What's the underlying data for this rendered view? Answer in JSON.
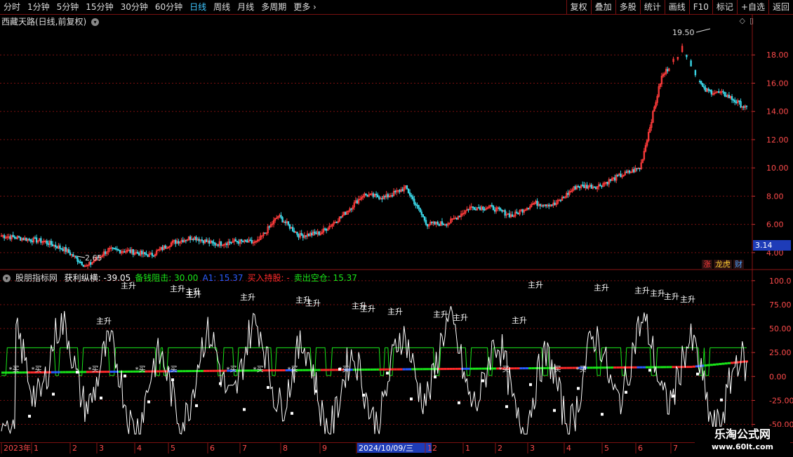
{
  "toolbar": {
    "timeframes": [
      "分时",
      "1分钟",
      "5分钟",
      "15分钟",
      "30分钟",
      "60分钟",
      "日线",
      "周线",
      "月线",
      "多周期",
      "更多"
    ],
    "active_timeframe": "日线",
    "tools": [
      "复权",
      "叠加",
      "多股",
      "统计",
      "画线",
      "F10",
      "标记",
      "+自选",
      "返回"
    ]
  },
  "upper_pane": {
    "stock_title": "西藏天路(日线,前复权)",
    "y_ticks": [
      "18.00",
      "16.00",
      "14.00",
      "12.00",
      "10.00",
      "8.00",
      "6.00",
      "4.00"
    ],
    "high_label": "19.50",
    "low_label": "2.65",
    "current_price": "3.14",
    "badges": [
      "涨",
      "龙虎",
      "财"
    ]
  },
  "lower_pane": {
    "indicator_name": "股朋指标网",
    "values": [
      {
        "label": "获利纵横: -39.05",
        "color": "#ffffff"
      },
      {
        "label": "备钱阻击: 30.00",
        "color": "#19e619"
      },
      {
        "label": "A1: 15.37",
        "color": "#2a5cff"
      },
      {
        "label": "买入持股: -",
        "color": "#ff2a2a"
      },
      {
        "label": "卖出空仓: 15.37",
        "color": "#19e619"
      }
    ],
    "y_ticks": [
      "100.0",
      "75.00",
      "50.00",
      "25.00",
      "0.00",
      "-25.00",
      "-50.00"
    ],
    "signal_up": "主升",
    "signal_buy": "买"
  },
  "date_axis": {
    "labels": [
      "2023年",
      "1",
      "2",
      "3",
      "4",
      "5",
      "6",
      "7",
      "8",
      "9",
      "2024/10/09/三",
      "12",
      "1",
      "2",
      "3",
      "4",
      "5",
      "6",
      "7"
    ],
    "highlighted": "2024/10/09/三"
  },
  "watermark": {
    "line1": "乐淘公式网",
    "line2": "www.60lt.com"
  },
  "chart_data": {
    "type": "candlestick+indicator",
    "upper_price_range": [
      3.0,
      19.9
    ],
    "lower_range": [
      -65,
      105
    ],
    "approx_close_path": [
      5.2,
      5.0,
      4.8,
      4.2,
      3.0,
      4.2,
      4.1,
      3.8,
      4.7,
      5.1,
      4.6,
      4.8,
      4.7,
      6.6,
      5.2,
      5.4,
      6.6,
      8.1,
      7.9,
      8.6,
      6.0,
      6.1,
      7.2,
      7.2,
      6.6,
      7.5,
      7.4,
      8.7,
      8.7,
      9.4,
      10.0,
      16.4,
      18.5,
      15.5,
      15.2,
      14.2
    ],
    "indicator_levels": {
      "备钱阻击": 30.0,
      "A1": 15.37
    }
  }
}
